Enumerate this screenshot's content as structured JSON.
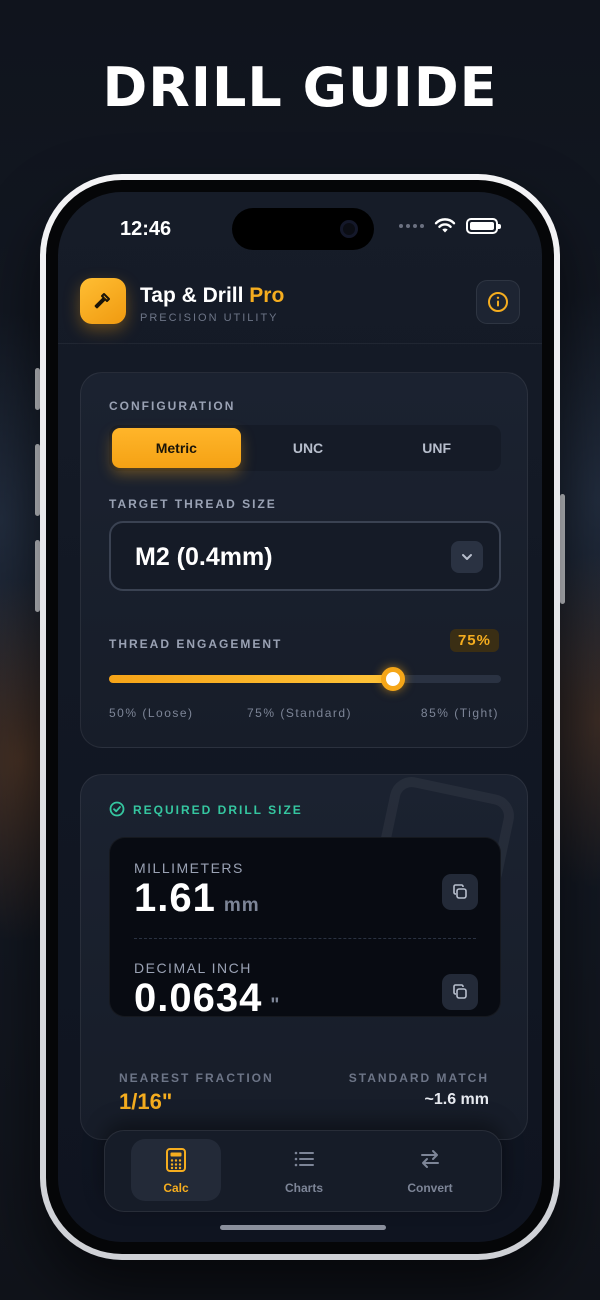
{
  "promo": {
    "title": "DRILL GUIDE"
  },
  "status_bar": {
    "time": "12:46"
  },
  "app": {
    "name": "Tap & Drill",
    "name_accent": "Pro",
    "subtitle": "PRECISION UTILITY"
  },
  "colors": {
    "accent": "#F5AD1F",
    "success": "#35C7A0",
    "background": "#121824"
  },
  "configuration": {
    "label": "CONFIGURATION",
    "options": [
      "Metric",
      "UNC",
      "UNF"
    ],
    "selected": "Metric"
  },
  "thread_size": {
    "label": "TARGET THREAD SIZE",
    "value": "M2 (0.4mm)"
  },
  "engagement": {
    "label": "THREAD ENGAGEMENT",
    "value_label": "75%",
    "value": 75,
    "ticks": [
      "50% (Loose)",
      "75% (Standard)",
      "85% (Tight)"
    ]
  },
  "result": {
    "label": "REQUIRED DRILL SIZE",
    "mm": {
      "label": "MILLIMETERS",
      "value": "1.61",
      "unit": "mm"
    },
    "inch": {
      "label": "DECIMAL INCH",
      "value": "0.0634",
      "unit": "\""
    },
    "fraction": {
      "label": "NEAREST FRACTION",
      "value": "1/16\""
    },
    "standard": {
      "label": "STANDARD MATCH",
      "value": "~1.6 mm"
    }
  },
  "tabs": [
    {
      "label": "Calc",
      "icon": "calculator-icon",
      "active": true
    },
    {
      "label": "Charts",
      "icon": "list-icon",
      "active": false
    },
    {
      "label": "Convert",
      "icon": "swap-arrows-icon",
      "active": false
    }
  ]
}
